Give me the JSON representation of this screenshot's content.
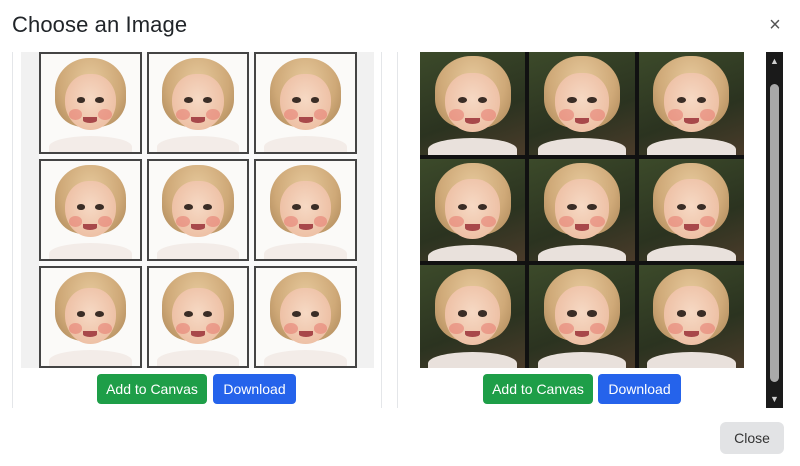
{
  "modal": {
    "title": "Choose an Image",
    "close_glyph": "×",
    "footer_close_label": "Close"
  },
  "cards": [
    {
      "style": "illustrated grid on white background",
      "tile_count": 9,
      "add_label": "Add to Canvas",
      "download_label": "Download"
    },
    {
      "style": "photorealistic grid on dark background",
      "tile_count": 9,
      "add_label": "Add to Canvas",
      "download_label": "Download"
    }
  ],
  "scrollbar": {
    "up_glyph": "▲",
    "down_glyph": "▼"
  },
  "colors": {
    "add_button": "#1e9e48",
    "download_button": "#2563eb",
    "close_button": "#e2e3e5"
  }
}
